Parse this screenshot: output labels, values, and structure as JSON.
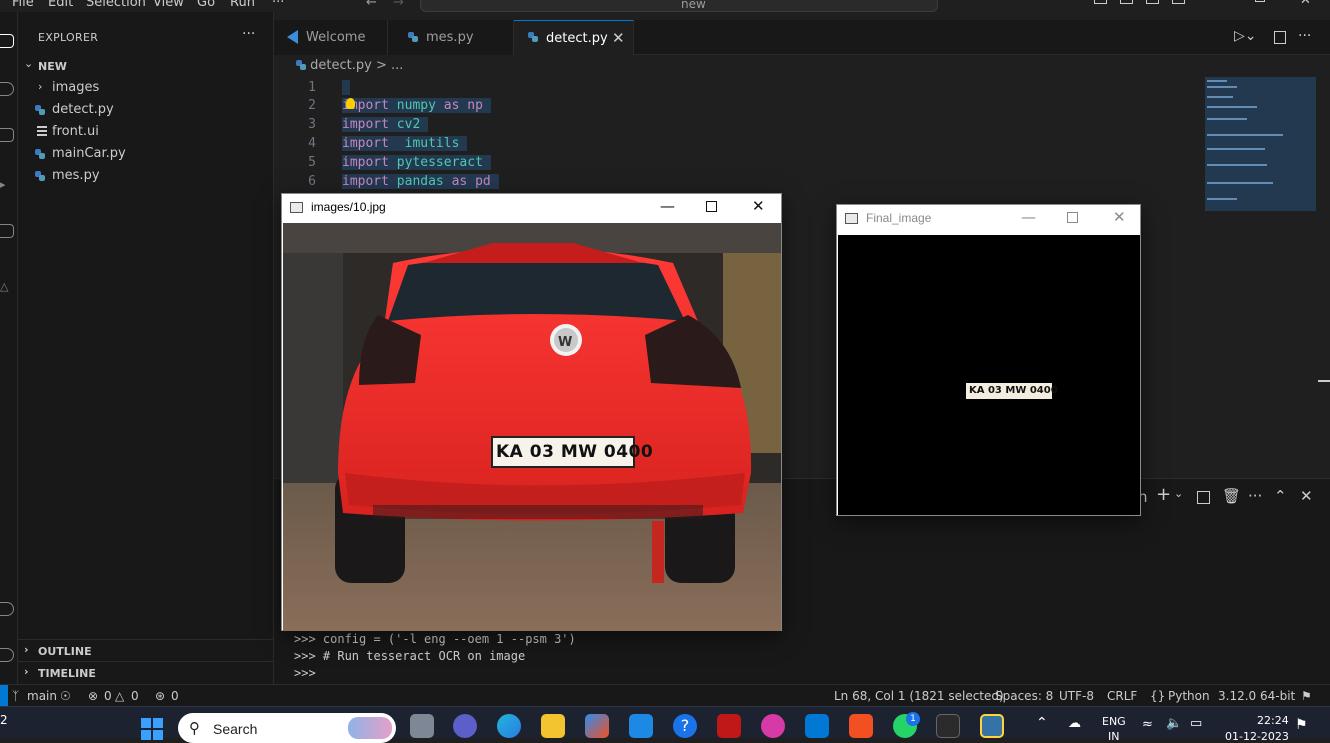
{
  "menu": [
    "File",
    "Edit",
    "Selection",
    "View",
    "Go",
    "Run",
    "···"
  ],
  "command_center": "new",
  "explorer": {
    "title": "EXPLORER",
    "folder": "NEW",
    "items": [
      {
        "label": "images",
        "kind": "folder"
      },
      {
        "label": "detect.py",
        "kind": "python"
      },
      {
        "label": "front.ui",
        "kind": "ui"
      },
      {
        "label": "mainCar.py",
        "kind": "python"
      },
      {
        "label": "mes.py",
        "kind": "python"
      }
    ],
    "outline": "OUTLINE",
    "timeline": "TIMELINE"
  },
  "tabs": [
    {
      "label": "Welcome",
      "active": false
    },
    {
      "label": "mes.py",
      "active": false
    },
    {
      "label": "detect.py",
      "active": true
    }
  ],
  "breadcrumb": {
    "file": "detect.py",
    "rest": "> ..."
  },
  "code": [
    {
      "n": "1",
      "kw": "",
      "mod": "",
      "extra": ""
    },
    {
      "n": "2",
      "kw": "import",
      "mod": "numpy",
      "extra": " as np"
    },
    {
      "n": "3",
      "kw": "import",
      "mod": "cv2",
      "extra": ""
    },
    {
      "n": "4",
      "kw": "import",
      "mod": " imutils",
      "extra": ""
    },
    {
      "n": "5",
      "kw": "import",
      "mod": "pytesseract",
      "extra": ""
    },
    {
      "n": "6",
      "kw": "import",
      "mod": "pandas",
      "extra": " as pd"
    }
  ],
  "terminal": [
    ">>> config = ('-l eng --oem 1 --psm 3')",
    ">>> # Run tesseract OCR on image",
    ">>>"
  ],
  "panel_partial": "n",
  "window_car": {
    "title": "images/10.jpg",
    "plate": "KA 03 MW 0400"
  },
  "window_final": {
    "title": "Final_image",
    "plate": "KA 03 MW 0400"
  },
  "status": {
    "branch": "main",
    "errors": "0",
    "warnings": "0",
    "ports": "0",
    "position": "Ln 68, Col 1 (1821 selected)",
    "spaces": "Spaces: 8",
    "encoding": "UTF-8",
    "eol": "CRLF",
    "language": "Python",
    "interpreter": "3.12.0 64-bit"
  },
  "taskbar": {
    "search_label": "Search",
    "lang_top": "ENG",
    "lang_bottom": "IN",
    "time": "22:24",
    "date": "01-12-2023",
    "whatsapp_badge": "1",
    "left_partial": "2"
  },
  "colors": {
    "accent": "#0078d4",
    "car_red": "#e8322e"
  },
  "icons": [
    "hamburger-icon",
    "search-icon",
    "play-icon",
    "split-icon",
    "more-icon",
    "python-file-icon",
    "vscode-icon",
    "windows-start-icon",
    "wifi-icon",
    "volume-icon",
    "battery-icon",
    "bell-icon"
  ]
}
